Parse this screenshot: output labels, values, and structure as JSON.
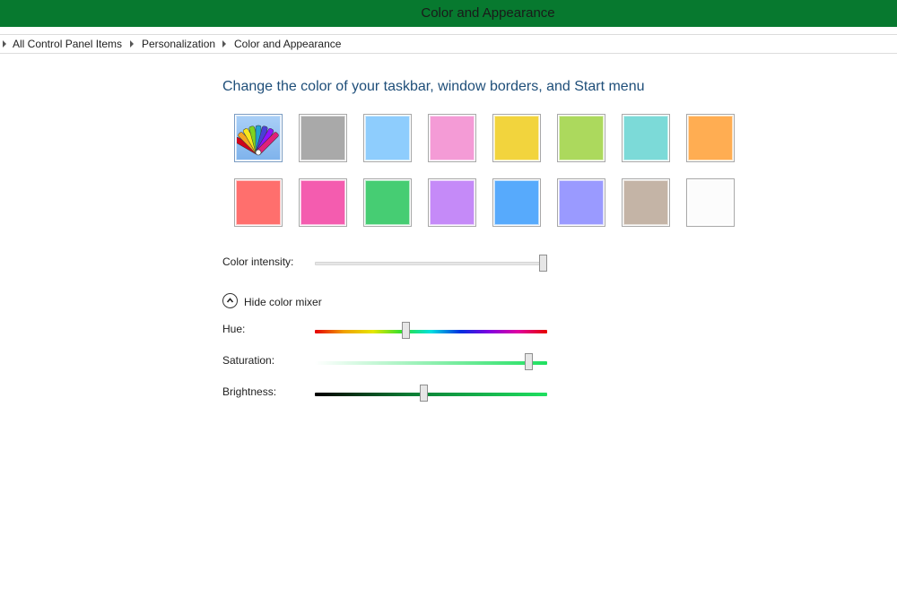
{
  "window": {
    "title": "Color and Appearance",
    "accent_color": "#07792f"
  },
  "breadcrumb": [
    "All Control Panel Items",
    "Personalization",
    "Color and Appearance"
  ],
  "main": {
    "heading": "Change the color of your taskbar, window borders, and Start menu",
    "swatches": [
      {
        "name": "automatic",
        "icon": "color-fan-icon",
        "color": "#8cbcf0",
        "selected": true
      },
      {
        "name": "gray",
        "color": "#a9a9a9"
      },
      {
        "name": "sky",
        "color": "#8ecdfd"
      },
      {
        "name": "pink",
        "color": "#f49bd6"
      },
      {
        "name": "yellow",
        "color": "#f2d43d"
      },
      {
        "name": "lime",
        "color": "#acd95d"
      },
      {
        "name": "teal",
        "color": "#7cdad8"
      },
      {
        "name": "orange",
        "color": "#ffad52"
      },
      {
        "name": "red",
        "color": "#ff6f6d"
      },
      {
        "name": "magenta",
        "color": "#f45caf"
      },
      {
        "name": "green",
        "color": "#46cd73"
      },
      {
        "name": "violet",
        "color": "#c58af8"
      },
      {
        "name": "blue",
        "color": "#57aafc"
      },
      {
        "name": "periwinkle",
        "color": "#9a9aff"
      },
      {
        "name": "taupe",
        "color": "#c4b4a6"
      },
      {
        "name": "white",
        "color": "#fcfcfc"
      }
    ],
    "intensity": {
      "label": "Color intensity:",
      "value": 1.0
    },
    "mixer_toggle": {
      "label": "Hide color mixer",
      "icon": "chevron-up-icon"
    },
    "hue": {
      "label": "Hue:",
      "value": 0.39
    },
    "saturation": {
      "label": "Saturation:",
      "value": 0.92
    },
    "brightness": {
      "label": "Brightness:",
      "value": 0.47
    }
  }
}
